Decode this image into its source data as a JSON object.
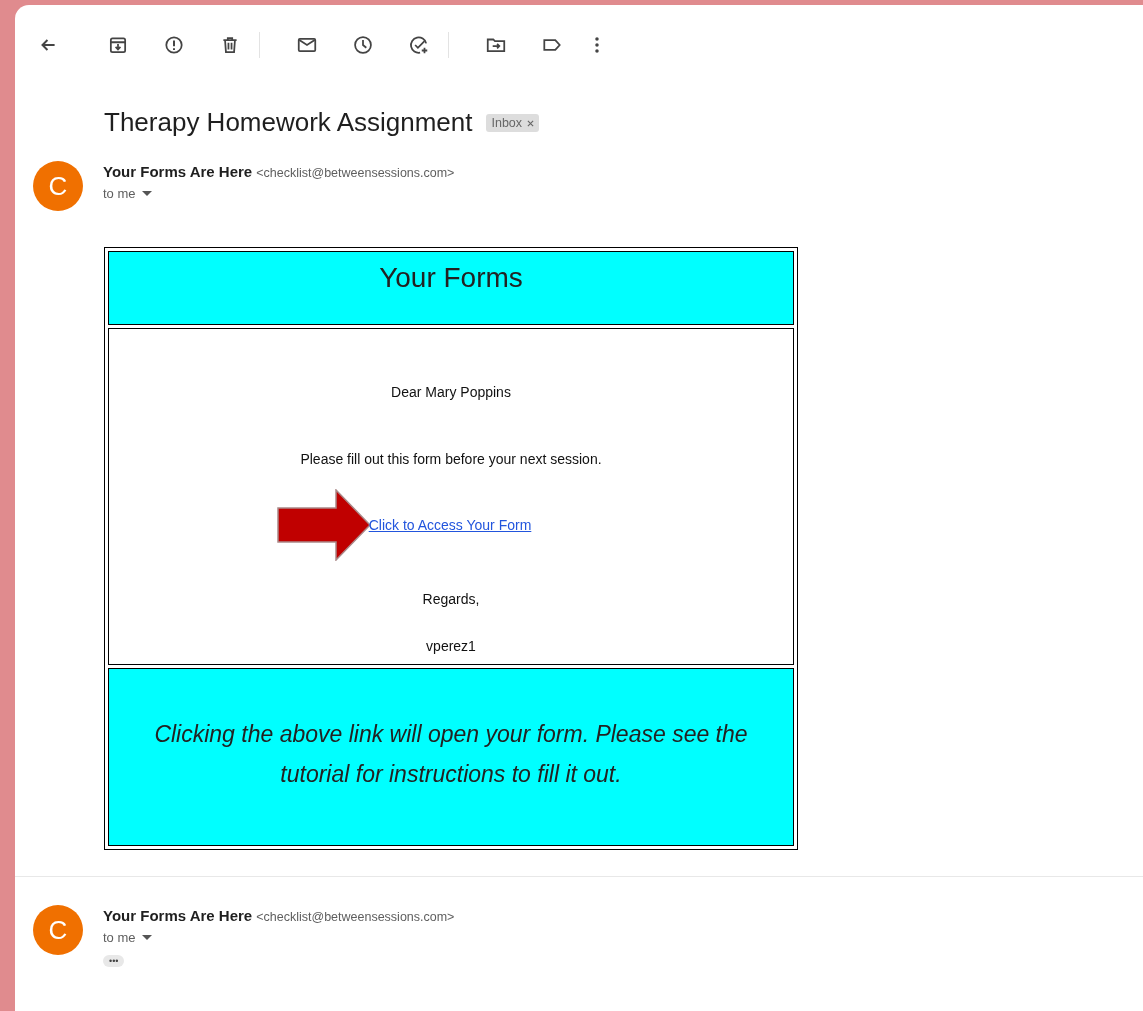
{
  "subject": "Therapy Homework Assignment",
  "labels": [
    {
      "text": "Inbox"
    }
  ],
  "messages": [
    {
      "avatar": "C",
      "sender": "Your Forms Are Here",
      "email": "<checklist@betweensessions.com>",
      "recipient": "to me",
      "body": {
        "header": "Your Forms",
        "greeting": "Dear Mary Poppins",
        "instruction": "Please fill out this form before your next session.",
        "link": "Click to Access Your Form",
        "closing": "Regards,",
        "signature": "vperez1",
        "footer": "Clicking the above link will open your form. Please see the tutorial for instructions to fill it out."
      }
    },
    {
      "avatar": "C",
      "sender": "Your Forms Are Here",
      "email": "<checklist@betweensessions.com>",
      "recipient": "to me",
      "collapsed": "•••"
    }
  ]
}
